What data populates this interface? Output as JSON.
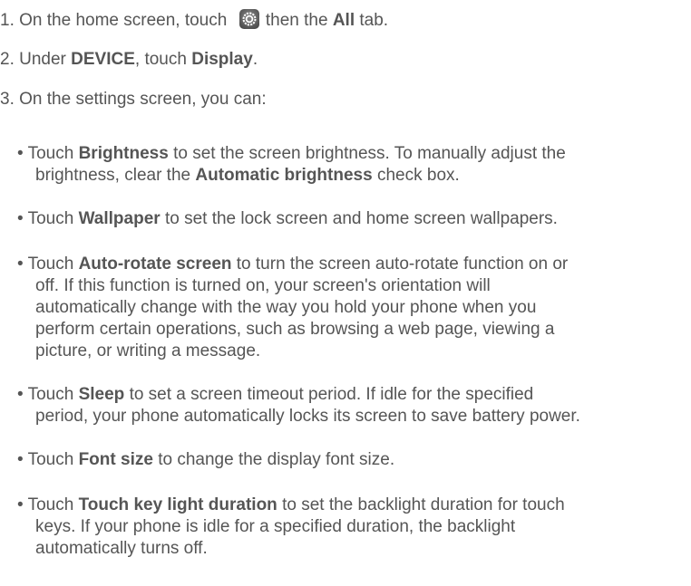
{
  "steps": {
    "s1": {
      "a": "1. On the home screen, touch",
      "b": "then the",
      "c": "All",
      "d": "tab."
    },
    "s2": {
      "a": "2. Under",
      "b": "DEVICE",
      "c": ", touch",
      "d": "Display",
      "e": "."
    },
    "s3": {
      "a": "3. On the settings screen, you can:"
    }
  },
  "bullets": {
    "brightness": {
      "a": "• Touch",
      "b": "Brightness",
      "c": "to set the screen brightness. To manually adjust the",
      "d": "brightness, clear the",
      "e": "Automatic brightness",
      "f": "check box."
    },
    "wallpaper": {
      "a": "• Touch",
      "b": "Wallpaper",
      "c": "to set the lock screen and home screen wallpapers."
    },
    "autorotate": {
      "a": "• Touch",
      "b": "Auto-rotate screen",
      "c": "to turn the screen auto-rotate function on or",
      "l2": "off. If this function is turned on, your screen's orientation will",
      "l3": "automatically change with the way you hold your phone when you",
      "l4": "perform certain operations, such as browsing a web page, viewing a",
      "l5": "picture, or writing a message."
    },
    "sleep": {
      "a": "• Touch",
      "b": "Sleep",
      "c": "to set a screen timeout period. If idle for the specified",
      "l2": "period, your phone automatically locks its screen to save battery power."
    },
    "fontsize": {
      "a": "• Touch",
      "b": "Font size",
      "c": "to change the display font size."
    },
    "touchkey": {
      "a": "• Touch",
      "b": "Touch key light duration",
      "c": "to set the backlight duration for touch",
      "l2": "keys. If your phone is idle for a specified duration, the backlight",
      "l3": "automatically turns off."
    }
  },
  "icons": {
    "settings": "settings-gear-icon"
  }
}
